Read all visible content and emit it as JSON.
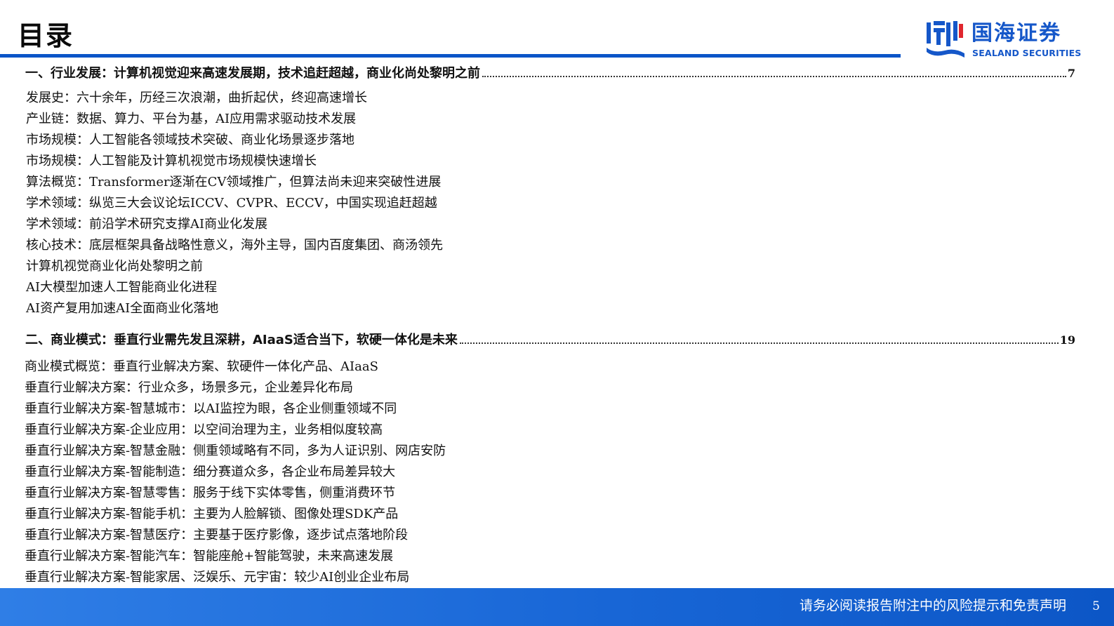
{
  "header": {
    "title": "目录",
    "logo": {
      "name_cn": "国海证券",
      "name_en": "SEALAND SECURITIES",
      "brand_color": "#1557c9"
    }
  },
  "toc": {
    "sections": [
      {
        "heading": "一、行业发展：计算机视觉迎来高速发展期，技术追赶超越，商业化尚处黎明之前",
        "page": "7",
        "items": [
          "发展史：六十余年，历经三次浪潮，曲折起伏，终迎高速增长",
          "产业链：数据、算力、平台为基，AI应用需求驱动技术发展",
          "市场规模：人工智能各领域技术突破、商业化场景逐步落地",
          "市场规模：人工智能及计算机视觉市场规模快速增长",
          "算法概览：Transformer逐渐在CV领域推广，但算法尚未迎来突破性进展",
          "学术领域：纵览三大会议论坛ICCV、CVPR、ECCV，中国实现追赶超越",
          "学术领域：前沿学术研究支撑AI商业化发展",
          "核心技术：底层框架具备战略性意义，海外主导，国内百度集团、商汤领先",
          "计算机视觉商业化尚处黎明之前",
          "AI大模型加速人工智能商业化进程",
          "AI资产复用加速AI全面商业化落地"
        ]
      },
      {
        "heading": "二、商业模式：垂直行业需先发且深耕，AIaaS适合当下，软硬一体化是未来",
        "page": "19",
        "items": [
          "商业模式概览：垂直行业解决方案、软硬件一体化产品、AIaaS",
          "垂直行业解决方案：行业众多，场景多元，企业差异化布局",
          "垂直行业解决方案-智慧城市：以AI监控为眼，各企业侧重领域不同",
          "垂直行业解决方案-企业应用：以空间治理为主，业务相似度较高",
          "垂直行业解决方案-智慧金融：侧重领域略有不同，多为人证识别、网店安防",
          "垂直行业解决方案-智能制造：细分赛道众多，各企业布局差异较大",
          "垂直行业解决方案-智慧零售：服务于线下实体零售，侧重消费环节",
          "垂直行业解决方案-智能手机：主要为人脸解锁、图像处理SDK产品",
          "垂直行业解决方案-智慧医疗：主要基于医疗影像，逐步试点落地阶段",
          "垂直行业解决方案-智能汽车：智能座舱+智能驾驶，未来高速发展",
          "垂直行业解决方案-智能家居、泛娱乐、元宇宙：较少AI创业企业布局"
        ]
      }
    ]
  },
  "footer": {
    "disclaimer": "请务必阅读报告附注中的风险提示和免责声明",
    "page_number": "5"
  },
  "colors": {
    "accent": "#0a55c8",
    "footer_bg": "#1866d6"
  }
}
